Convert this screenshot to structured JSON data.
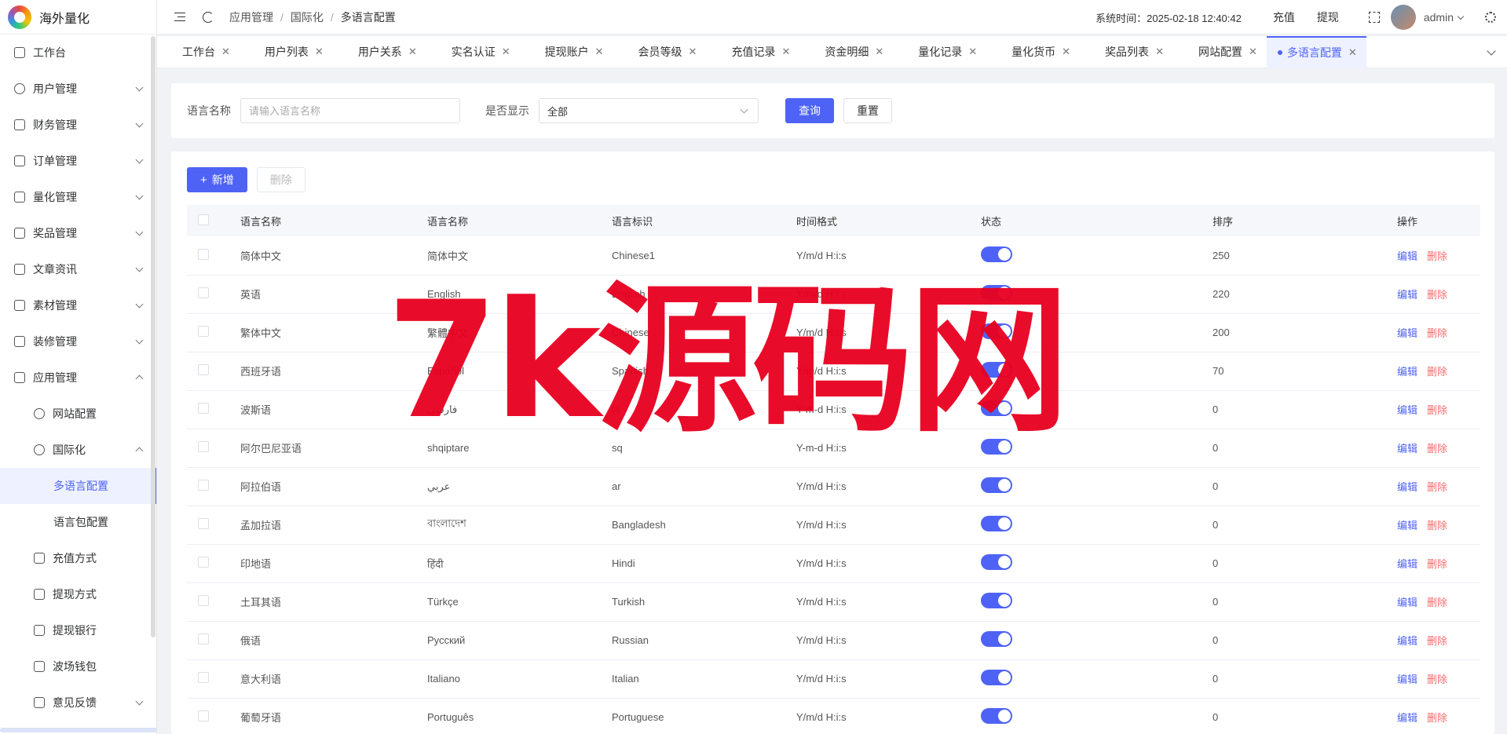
{
  "app": {
    "title": "海外量化"
  },
  "sidebar": {
    "items": [
      {
        "label": "工作台",
        "icon": "monitor-icon",
        "level": 0,
        "expandable": false
      },
      {
        "label": "用户管理",
        "icon": "user-icon",
        "level": 0,
        "expandable": true
      },
      {
        "label": "财务管理",
        "icon": "chart-icon",
        "level": 0,
        "expandable": true
      },
      {
        "label": "订单管理",
        "icon": "order-icon",
        "level": 0,
        "expandable": true
      },
      {
        "label": "量化管理",
        "icon": "quant-icon",
        "level": 0,
        "expandable": true
      },
      {
        "label": "奖品管理",
        "icon": "gift-icon",
        "level": 0,
        "expandable": true
      },
      {
        "label": "文章资讯",
        "icon": "article-icon",
        "level": 0,
        "expandable": true
      },
      {
        "label": "素材管理",
        "icon": "image-icon",
        "level": 0,
        "expandable": true
      },
      {
        "label": "装修管理",
        "icon": "decor-icon",
        "level": 0,
        "expandable": true
      },
      {
        "label": "应用管理",
        "icon": "app-icon",
        "level": 0,
        "expandable": true,
        "open": true
      },
      {
        "label": "网站配置",
        "icon": "globe-icon",
        "level": 1,
        "expandable": false
      },
      {
        "label": "国际化",
        "icon": "i18n-icon",
        "level": 1,
        "expandable": true,
        "open": true
      },
      {
        "label": "多语言配置",
        "icon": "",
        "level": 2,
        "expandable": false,
        "active": true
      },
      {
        "label": "语言包配置",
        "icon": "",
        "level": 2,
        "expandable": false
      },
      {
        "label": "充值方式",
        "icon": "recharge-icon",
        "level": 1,
        "expandable": false
      },
      {
        "label": "提现方式",
        "icon": "withdraw-icon",
        "level": 1,
        "expandable": false
      },
      {
        "label": "提现银行",
        "icon": "bank-icon",
        "level": 1,
        "expandable": false
      },
      {
        "label": "波场钱包",
        "icon": "wallet-icon",
        "level": 1,
        "expandable": false
      },
      {
        "label": "意见反馈",
        "icon": "feedback-icon",
        "level": 1,
        "expandable": true
      }
    ]
  },
  "header": {
    "breadcrumb": [
      "应用管理",
      "国际化",
      "多语言配置"
    ],
    "system_time": "系统时间：2025-02-18 12:40:42",
    "recharge": "充值",
    "withdraw": "提现",
    "username": "admin"
  },
  "tabs": [
    {
      "label": "工作台"
    },
    {
      "label": "用户列表"
    },
    {
      "label": "用户关系"
    },
    {
      "label": "实名认证"
    },
    {
      "label": "提现账户"
    },
    {
      "label": "会员等级"
    },
    {
      "label": "充值记录"
    },
    {
      "label": "资金明细"
    },
    {
      "label": "量化记录"
    },
    {
      "label": "量化货币"
    },
    {
      "label": "奖品列表"
    },
    {
      "label": "网站配置"
    },
    {
      "label": "多语言配置",
      "active": true
    }
  ],
  "search": {
    "name_label": "语言名称",
    "name_placeholder": "请输入语言名称",
    "show_label": "是否显示",
    "show_value": "全部",
    "query": "查询",
    "reset": "重置"
  },
  "toolbar": {
    "add": "新增",
    "delete": "删除"
  },
  "table": {
    "columns": [
      "语言名称",
      "语言名称",
      "语言标识",
      "时间格式",
      "状态",
      "排序",
      "操作"
    ],
    "edit": "编辑",
    "delete": "删除",
    "rows": [
      {
        "name": "简体中文",
        "native": "简体中文",
        "code": "Chinese1",
        "fmt": "Y/m/d H:i:s",
        "on": true,
        "sort": "250"
      },
      {
        "name": "英语",
        "native": "English",
        "code": "English",
        "fmt": "Y/m/d H:i:s",
        "on": true,
        "sort": "220"
      },
      {
        "name": "繁体中文",
        "native": "繁體中文",
        "code": "Chinese",
        "fmt": "Y/m/d H:i:s",
        "on": true,
        "sort": "200"
      },
      {
        "name": "西班牙语",
        "native": "Español",
        "code": "Spanish",
        "fmt": "Y/m/d H:i:s",
        "on": true,
        "sort": "70"
      },
      {
        "name": "波斯语",
        "native": "فارسی",
        "code": "fa",
        "fmt": "Y-m-d H:i:s",
        "on": true,
        "sort": "0"
      },
      {
        "name": "阿尔巴尼亚语",
        "native": "shqiptare",
        "code": "sq",
        "fmt": "Y-m-d H:i:s",
        "on": true,
        "sort": "0"
      },
      {
        "name": "阿拉伯语",
        "native": "عربي",
        "code": "ar",
        "fmt": "Y/m/d H:i:s",
        "on": true,
        "sort": "0"
      },
      {
        "name": "孟加拉语",
        "native": "বাংলাদেশ",
        "code": "Bangladesh",
        "fmt": "Y/m/d H:i:s",
        "on": true,
        "sort": "0"
      },
      {
        "name": "印地语",
        "native": "हिंदी",
        "code": "Hindi",
        "fmt": "Y/m/d H:i:s",
        "on": true,
        "sort": "0"
      },
      {
        "name": "土耳其语",
        "native": "Türkçe",
        "code": "Turkish",
        "fmt": "Y/m/d H:i:s",
        "on": true,
        "sort": "0"
      },
      {
        "name": "俄语",
        "native": "Русский",
        "code": "Russian",
        "fmt": "Y/m/d H:i:s",
        "on": true,
        "sort": "0"
      },
      {
        "name": "意大利语",
        "native": "Italiano",
        "code": "Italian",
        "fmt": "Y/m/d H:i:s",
        "on": true,
        "sort": "0"
      },
      {
        "name": "葡萄牙语",
        "native": "Português",
        "code": "Portuguese",
        "fmt": "Y/m/d H:i:s",
        "on": true,
        "sort": "0"
      }
    ]
  },
  "watermark": "7k源码网",
  "colors": {
    "accent": "#4e63f5",
    "danger": "#f56c6c",
    "watermark": "#e8001f"
  }
}
